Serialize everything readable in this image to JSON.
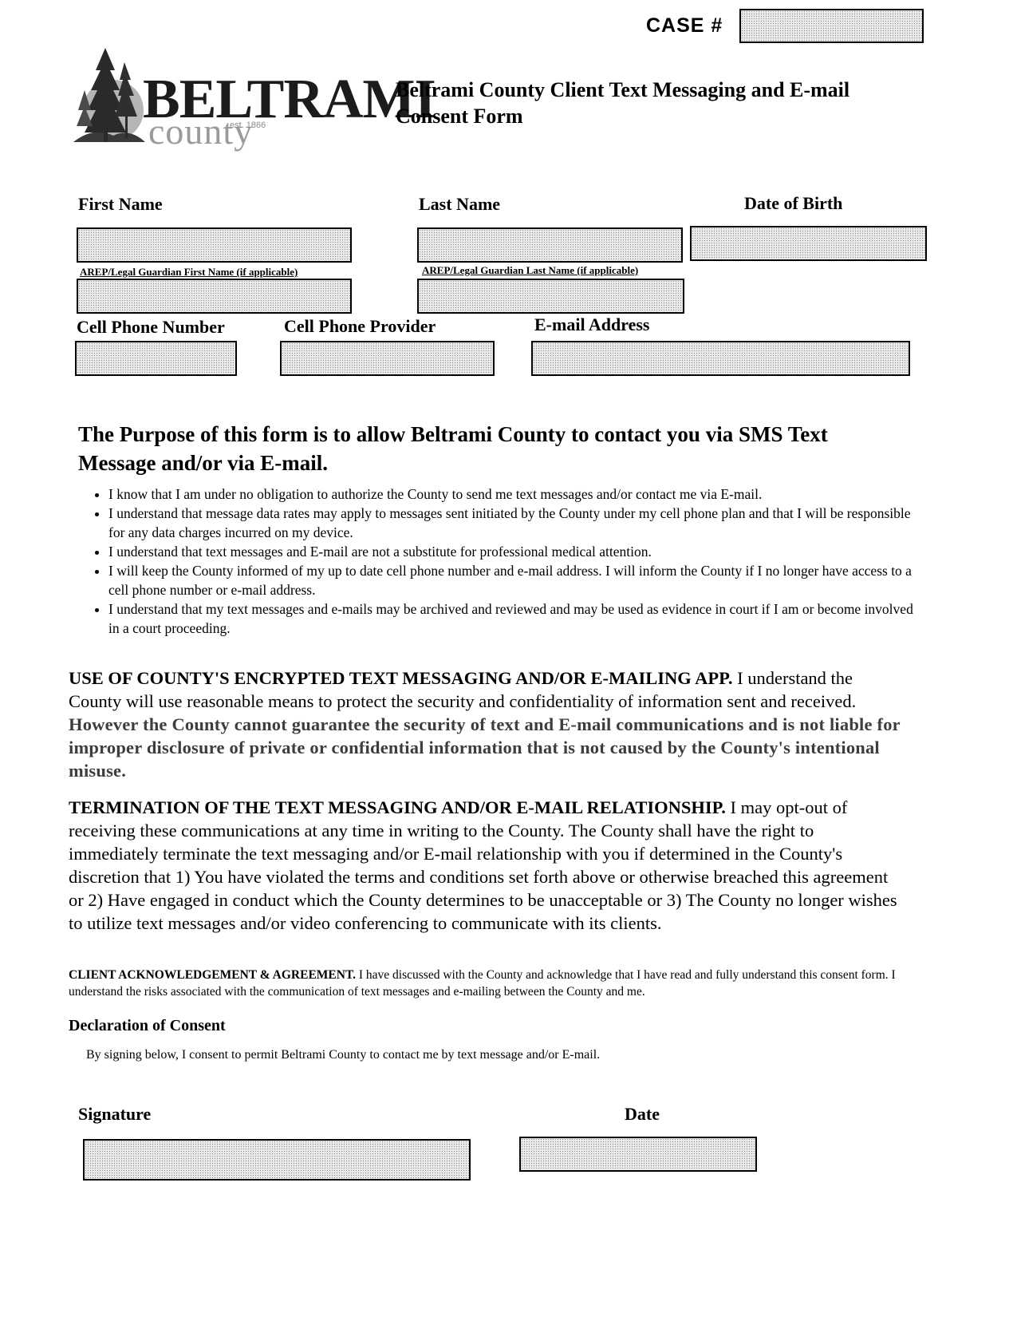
{
  "header": {
    "case_label": "CASE #",
    "logo": {
      "name": "BELTRAMI",
      "subname": "county",
      "est": "est. 1866",
      "icon": "pine-trees-icon"
    },
    "title_line1": "Beltrami County Client Text Messaging and E-mail",
    "title_line2": "Consent Form"
  },
  "fields": {
    "first_name": {
      "label": "First Name",
      "value": ""
    },
    "last_name": {
      "label": "Last Name",
      "value": ""
    },
    "dob": {
      "label": "Date of Birth",
      "value": ""
    },
    "arep_first": {
      "label": "AREP/Legal Guardian First Name (if applicable)",
      "value": ""
    },
    "arep_last": {
      "label": "AREP/Legal Guardian Last Name (if applicable)",
      "value": ""
    },
    "cell_phone": {
      "label": "Cell Phone Number",
      "value": ""
    },
    "provider": {
      "label": "Cell Phone Provider",
      "value": ""
    },
    "email": {
      "label": "E-mail Address",
      "value": ""
    },
    "case_number": {
      "value": ""
    },
    "signature": {
      "label": "Signature",
      "value": ""
    },
    "sign_date": {
      "label": "Date",
      "value": ""
    }
  },
  "purpose": {
    "heading_line1": "The Purpose of this form is to allow Beltrami County to contact you via SMS Text",
    "heading_line2": "Message and/or via E-mail.",
    "bullets": [
      "I know that I am under no obligation to authorize the County to send me text messages and/or contact me via E-mail.",
      "I understand that message data rates may apply to messages sent initiated by the County under my cell phone plan and that I will be responsible for any data charges incurred on my device.",
      "I understand that text messages and E-mail are not a substitute for professional medical attention.",
      "I will keep the County informed of my up to date cell phone number and e-mail address. I will inform the County if I no longer have access to a cell phone number or e-mail address.",
      "I understand that my text messages and e-mails may be archived and reviewed and may be used as evidence in court if I am or become involved in a court proceeding."
    ]
  },
  "use_section": {
    "heading": "USE OF COUNTY'S ENCRYPTED TEXT MESSAGING AND/OR E-MAILING APP.",
    "body": " I understand the County will use reasonable means to protect the security and confidentiality of information sent and received. ",
    "emphasis": "However the County cannot guarantee the security of text and E-mail communications and is not liable for improper disclosure of private or confidential information that is not caused by the County's intentional misuse."
  },
  "termination": {
    "heading": "TERMINATION OF THE TEXT MESSAGING AND/OR E-MAIL RELATIONSHIP.",
    "body": " I may opt-out of receiving these communications at any time in writing to the County. The County shall have the right to immediately terminate the text messaging and/or E-mail relationship with you if determined in the County's discretion that 1) You have violated the terms and conditions set forth above or otherwise breached this agreement or 2) Have engaged in conduct which the County determines to be unacceptable or 3) The County no longer wishes to utilize text messages and/or video conferencing to communicate with its clients."
  },
  "acknowledgement": {
    "heading": "CLIENT ACKNOWLEDGEMENT & AGREEMENT.",
    "body": " I have discussed with the County and acknowledge that I have read and fully understand this consent form. I understand the risks associated with the communication of text messages and e-mailing between the County and me."
  },
  "declaration": {
    "heading": "Declaration of Consent",
    "body": "By  signing below, I consent to permit Beltrami County to contact me by text message and/or E-mail."
  }
}
